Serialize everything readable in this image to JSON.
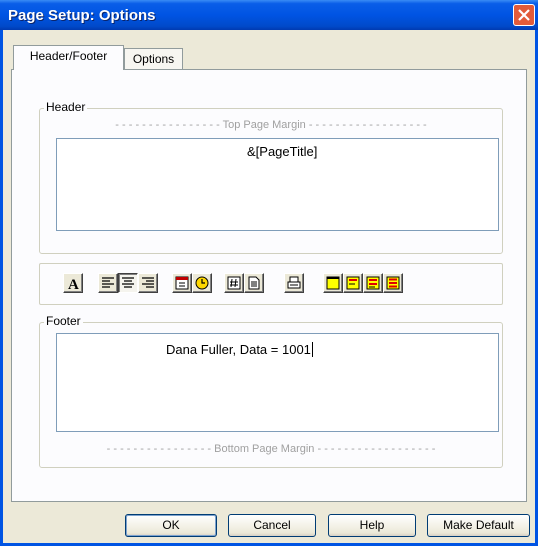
{
  "window": {
    "title": "Page Setup: Options"
  },
  "tabs": [
    {
      "label": "Header/Footer"
    },
    {
      "label": "Options"
    }
  ],
  "header_group": {
    "label": "Header",
    "top_margin_label": "Top Page Margin",
    "value": "&[PageTitle]"
  },
  "toolbar": {
    "buttons": [
      {
        "icon": "font-icon"
      },
      {
        "icon": "align-left-icon"
      },
      {
        "icon": "align-center-icon"
      },
      {
        "icon": "align-right-icon"
      },
      {
        "icon": "date-icon"
      },
      {
        "icon": "clock-icon"
      },
      {
        "icon": "page-number-icon"
      },
      {
        "icon": "page-count-icon"
      },
      {
        "icon": "print-icon"
      },
      {
        "icon": "level-1-icon"
      },
      {
        "icon": "level-2-icon"
      },
      {
        "icon": "level-3-icon"
      },
      {
        "icon": "level-4-icon"
      }
    ]
  },
  "footer_group": {
    "label": "Footer",
    "value": "Dana Fuller, Data = 1001",
    "bottom_margin_label": "Bottom Page Margin"
  },
  "buttons": {
    "ok": "OK",
    "cancel": "Cancel",
    "help": "Help",
    "make_default": "Make Default"
  },
  "colors": {
    "titlebar": "#0054e3",
    "close": "#e25b3a",
    "icon_yellow": "#ffff00",
    "icon_red": "#e00000"
  }
}
